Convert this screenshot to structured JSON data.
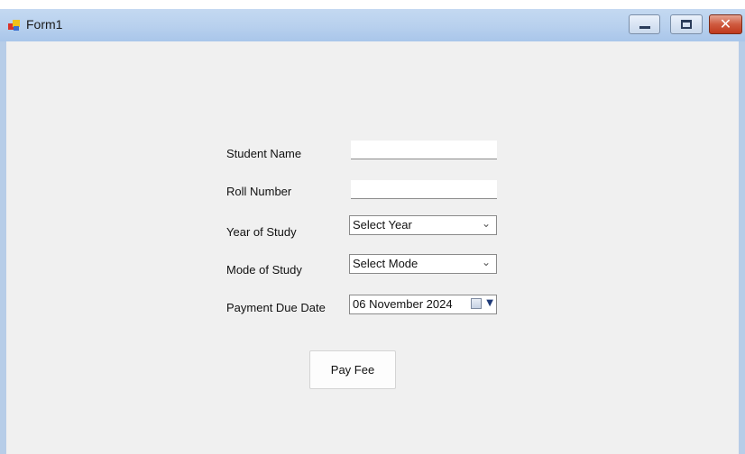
{
  "window": {
    "title": "Form1",
    "controls": {
      "minimize": "minimize",
      "maximize": "maximize",
      "close": "✕"
    }
  },
  "form": {
    "student_name": {
      "label": "Student Name",
      "value": ""
    },
    "roll_number": {
      "label": "Roll Number",
      "value": ""
    },
    "year_of_study": {
      "label": "Year of Study",
      "selected": "Select Year"
    },
    "mode_of_study": {
      "label": "Mode of Study",
      "selected": "Select Mode"
    },
    "payment_due_date": {
      "label": "Payment Due Date",
      "value": "06 November 2024"
    },
    "submit_label": "Pay Fee"
  },
  "icons": {
    "app": "app-icon",
    "calendar": "calendar-icon",
    "chevron": "chevron-down-icon"
  },
  "colors": {
    "titlebar": "#b9d1ee",
    "client_bg": "#f0f0f0",
    "close_button": "#c9482a"
  }
}
